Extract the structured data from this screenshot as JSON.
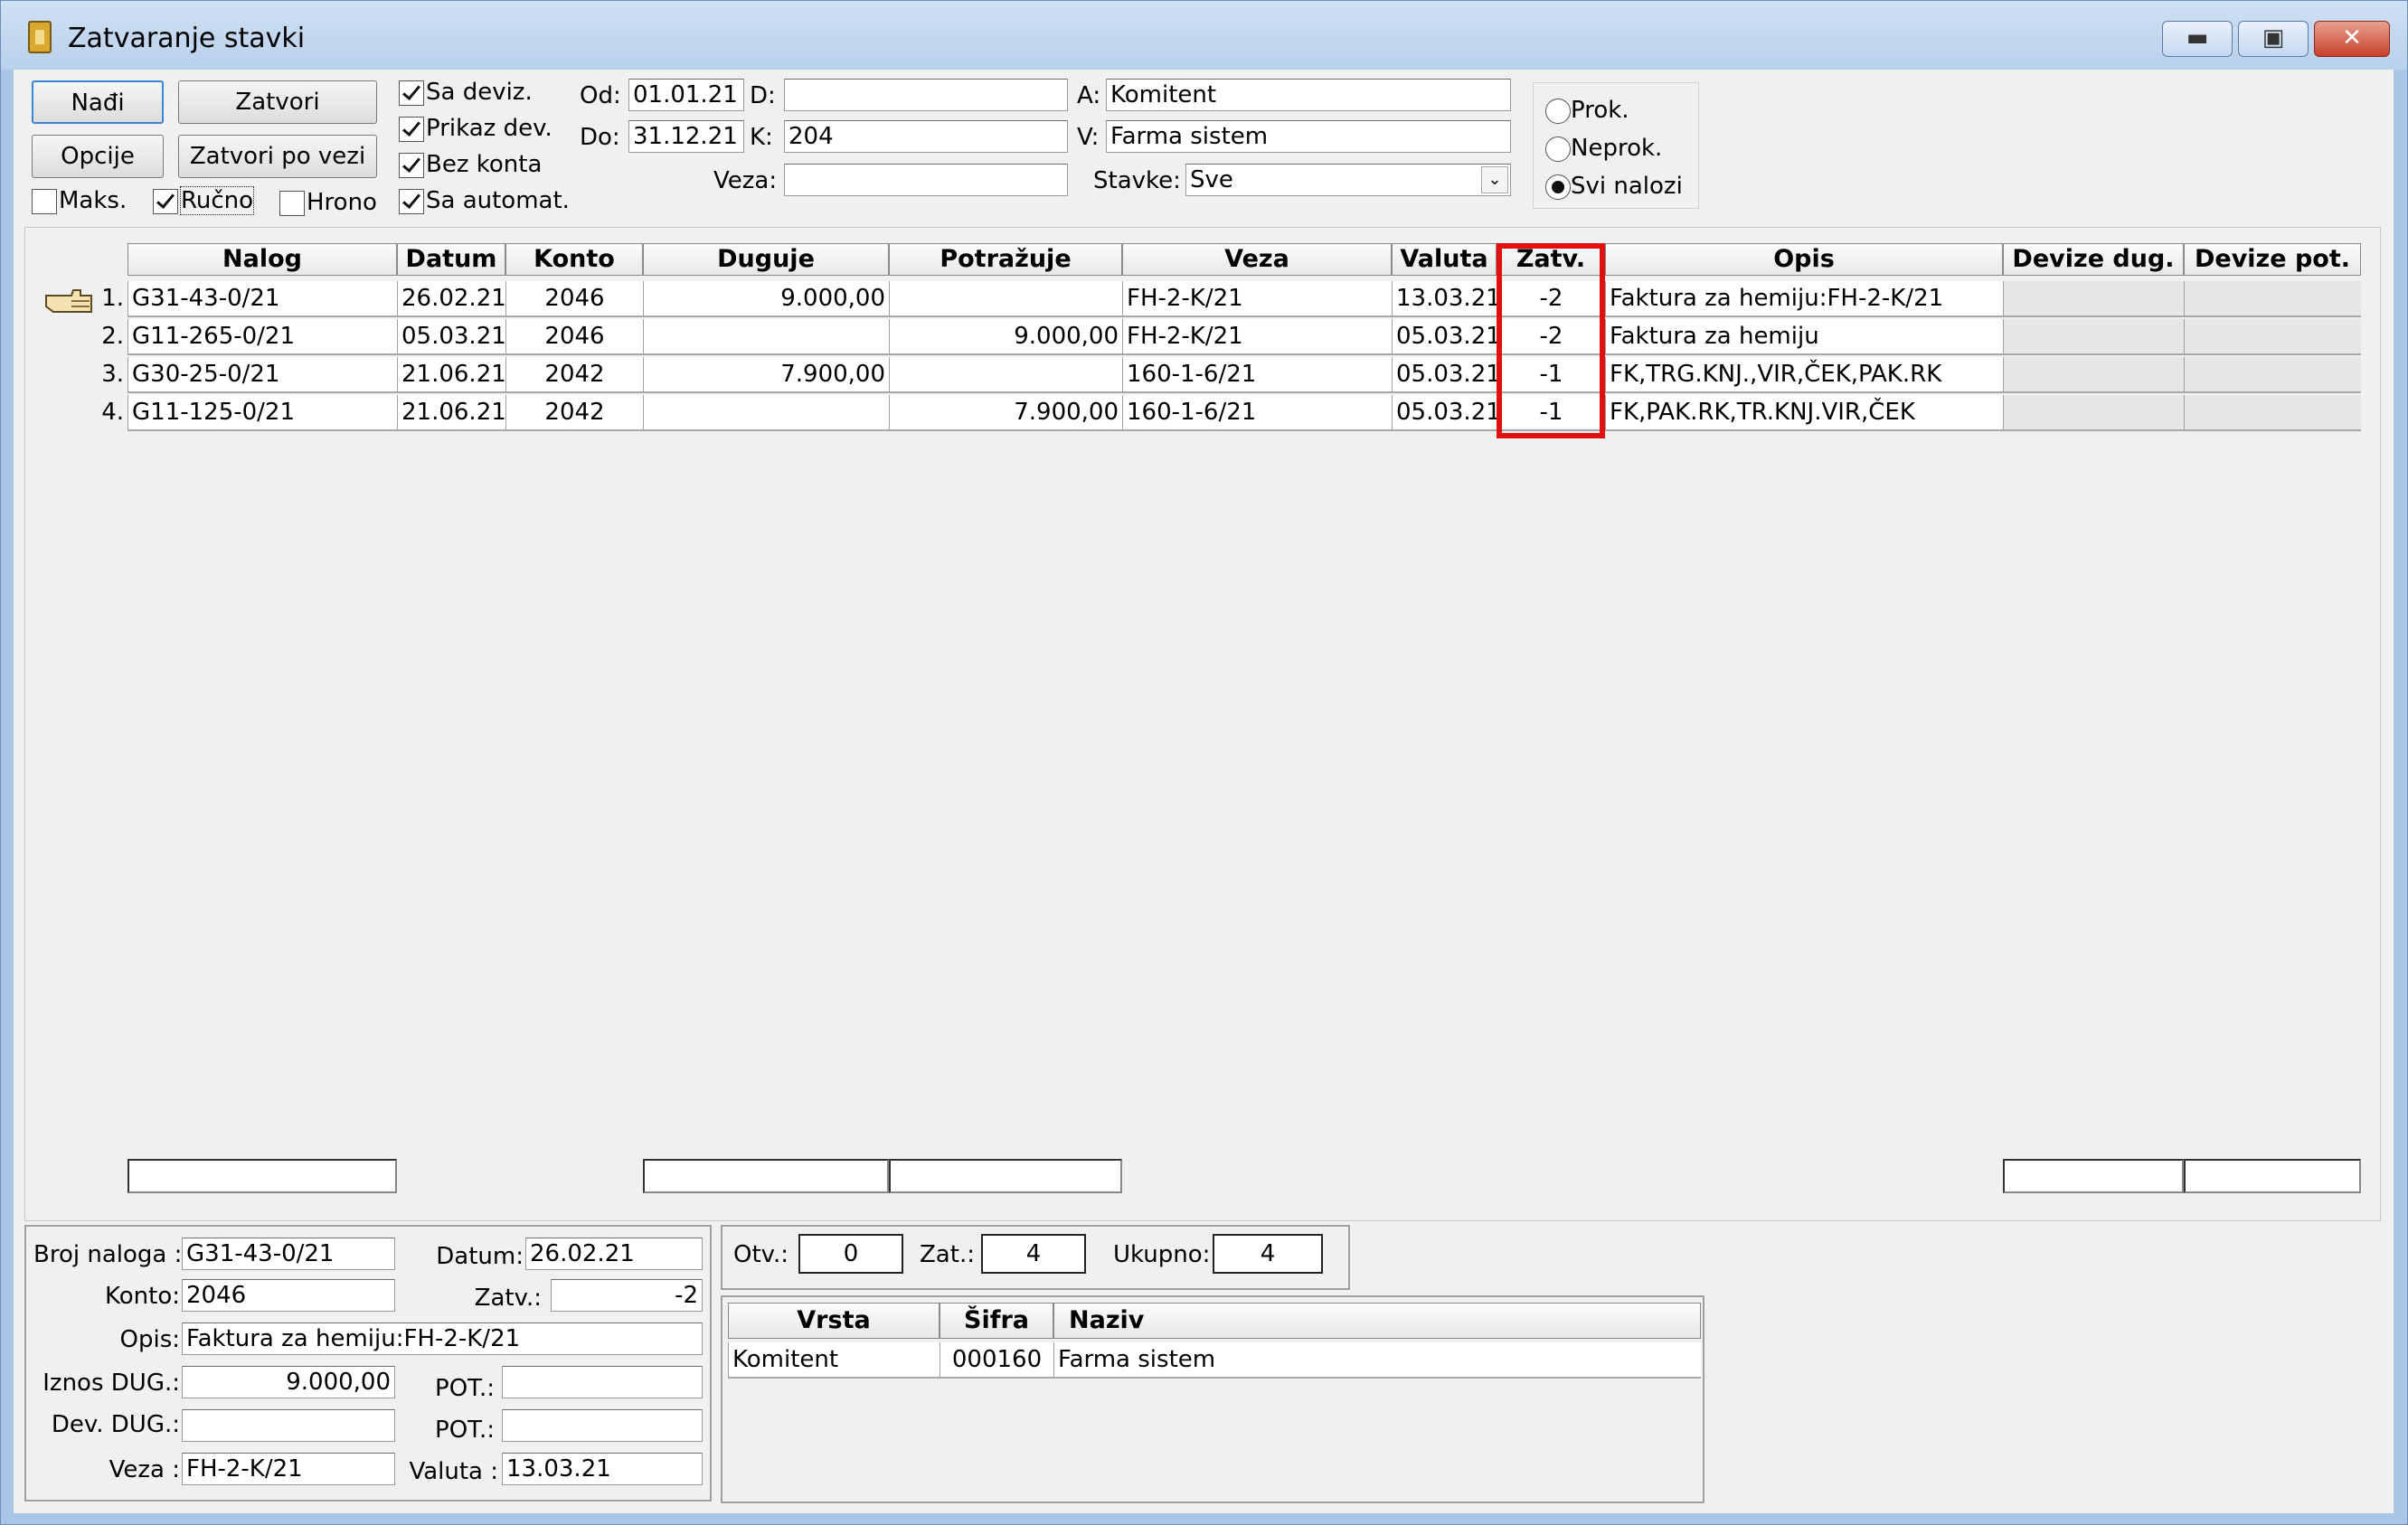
{
  "window": {
    "title": "Zatvaranje stavki"
  },
  "toolbar": {
    "nadji": "Nađi",
    "zatvori": "Zatvori",
    "opcije": "Opcije",
    "zatvori_po_vezi": "Zatvori po vezi"
  },
  "checks": {
    "sa_deviz": "Sa deviz.",
    "prikaz_dev": "Prikaz dev.",
    "bez_konta": "Bez konta",
    "sa_automat": "Sa automat.",
    "maks": "Maks.",
    "rucno": "Ručno",
    "hrono": "Hrono"
  },
  "filters": {
    "od_label": "Od:",
    "od_value": "01.01.21",
    "do_label": "Do:",
    "do_value": "31.12.21",
    "d_label": "D:",
    "d_value": "",
    "k_label": "K:",
    "k_value": "204",
    "veza_label": "Veza:",
    "veza_value": "",
    "a_label": "A:",
    "a_value": "Komitent",
    "v_label": "V:",
    "v_value": "Farma sistem",
    "stavke_label": "Stavke:",
    "stavke_value": "Sve"
  },
  "radios": {
    "prok": "Prok.",
    "neprok": "Neprok.",
    "svi": "Svi nalozi"
  },
  "grid": {
    "headers": [
      "Nalog",
      "Datum",
      "Konto",
      "Duguje",
      "Potražuje",
      "Veza",
      "Valuta",
      "Zatv.",
      "Opis",
      "Devize dug.",
      "Devize pot."
    ],
    "rows": [
      {
        "n": "1.",
        "nalog": "G31-43-0/21",
        "datum": "26.02.21",
        "konto": "2046",
        "duguje": "9.000,00",
        "potrazuje": "",
        "veza": "FH-2-K/21",
        "valuta": "13.03.21",
        "zatv": "-2",
        "opis": "Faktura za hemiju:FH-2-K/21"
      },
      {
        "n": "2.",
        "nalog": "G11-265-0/21",
        "datum": "05.03.21",
        "konto": "2046",
        "duguje": "",
        "potrazuje": "9.000,00",
        "veza": "FH-2-K/21",
        "valuta": "05.03.21",
        "zatv": "-2",
        "opis": "Faktura za hemiju"
      },
      {
        "n": "3.",
        "nalog": "G30-25-0/21",
        "datum": "21.06.21",
        "konto": "2042",
        "duguje": "7.900,00",
        "potrazuje": "",
        "veza": "160-1-6/21",
        "valuta": "05.03.21",
        "zatv": "-1",
        "opis": "FK,TRG.KNJ.,VIR,ČEK,PAK.RK"
      },
      {
        "n": "4.",
        "nalog": "G11-125-0/21",
        "datum": "21.06.21",
        "konto": "2042",
        "duguje": "",
        "potrazuje": "7.900,00",
        "veza": "160-1-6/21",
        "valuta": "05.03.21",
        "zatv": "-1",
        "opis": "FK,PAK.RK,TR.KNJ.VIR,ČEK"
      }
    ]
  },
  "detail": {
    "broj_naloga_label": "Broj naloga :",
    "broj_naloga": "G31-43-0/21",
    "datum_label": "Datum:",
    "datum": "26.02.21",
    "konto_label": "Konto:",
    "konto": "2046",
    "zatv_label": "Zatv.:",
    "zatv": "-2",
    "opis_label": "Opis:",
    "opis": "Faktura za hemiju:FH-2-K/21",
    "iznos_dug_label": "Iznos DUG.:",
    "iznos_dug": "9.000,00",
    "pot_label": "POT.:",
    "pot": "",
    "dev_dug_label": "Dev. DUG.:",
    "dev_dug": "",
    "dev_pot_label": "POT.:",
    "dev_pot": "",
    "veza_label": "Veza :",
    "veza": "FH-2-K/21",
    "valuta_label": "Valuta :",
    "valuta": "13.03.21"
  },
  "summary": {
    "otv_label": "Otv.:",
    "otv": "0",
    "zat_label": "Zat.:",
    "zat": "4",
    "ukupno_label": "Ukupno:",
    "ukupno": "4"
  },
  "komitent_grid": {
    "headers": [
      "Vrsta",
      "Šifra",
      "Naziv"
    ],
    "rows": [
      {
        "vrsta": "Komitent",
        "sifra": "000160",
        "naziv": "Farma sistem"
      }
    ]
  }
}
